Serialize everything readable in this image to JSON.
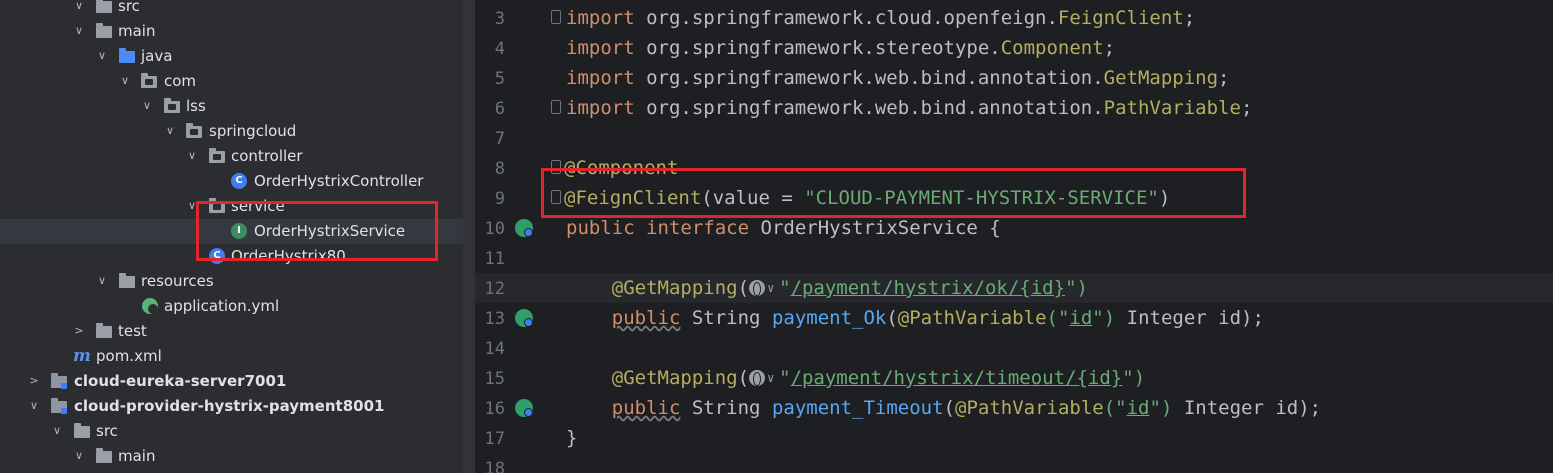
{
  "project_tree": {
    "items": [
      {
        "label": "src",
        "kind": "folder"
      },
      {
        "label": "main",
        "kind": "folder"
      },
      {
        "label": "java",
        "kind": "source-folder"
      },
      {
        "label": "com",
        "kind": "package"
      },
      {
        "label": "lss",
        "kind": "package"
      },
      {
        "label": "springcloud",
        "kind": "package"
      },
      {
        "label": "controller",
        "kind": "package"
      },
      {
        "label": "OrderHystrixController",
        "kind": "class",
        "badge": "C"
      },
      {
        "label": "service",
        "kind": "package"
      },
      {
        "label": "OrderHystrixService",
        "kind": "interface",
        "badge": "I"
      },
      {
        "label": "OrderHystrix80",
        "kind": "class"
      },
      {
        "label": "resources",
        "kind": "folder"
      },
      {
        "label": "application.yml",
        "kind": "yaml"
      },
      {
        "label": "test",
        "kind": "folder"
      },
      {
        "label": "pom.xml",
        "kind": "maven",
        "badge": "m"
      },
      {
        "label": "cloud-eureka-server7001",
        "kind": "module"
      },
      {
        "label": "cloud-provider-hystrix-payment8001",
        "kind": "module"
      },
      {
        "label": "src",
        "kind": "folder"
      },
      {
        "label": "main",
        "kind": "folder"
      }
    ]
  },
  "editor": {
    "line_numbers": [
      "3",
      "4",
      "5",
      "6",
      "7",
      "8",
      "9",
      "10",
      "11",
      "12",
      "13",
      "14",
      "15",
      "16",
      "17",
      "18"
    ],
    "imports": {
      "kw": "import",
      "l3_pkg": "org.springframework.cloud.openfeign.",
      "l3_cls": "FeignClient",
      "l4_pkg": "org.springframework.stereotype.",
      "l4_cls": "Component",
      "l5_pkg": "org.springframework.web.bind.annotation.",
      "l5_cls": "GetMapping",
      "l6_pkg": "org.springframework.web.bind.annotation.",
      "l6_cls": "PathVariable",
      "semi": ";"
    },
    "l8_ann": "@Component",
    "l9_ann": "@FeignClient",
    "l9_attr": "(value = ",
    "l9_str": "\"CLOUD-PAYMENT-HYSTRIX-SERVICE\"",
    "l9_end": ")",
    "l10_public": "public",
    "l10_interface": "interface",
    "l10_name": "OrderHystrixService {",
    "l12_ann": "@GetMapping",
    "open_paren": "(",
    "quote": "\"",
    "l12_path": "/payment/hystrix/ok/{id}",
    "close": "\")",
    "l13_public": "public",
    "l13_type": "String",
    "l13_fn": "payment_Ok",
    "pv_ann": "@PathVariable",
    "pv_open": "(\"",
    "pv_id": "id",
    "pv_close": "\")",
    "param": "Integer id);",
    "l15_path": "/payment/hystrix/timeout/{id}",
    "l16_fn": "payment_Timeout",
    "l17_brace": "}"
  }
}
